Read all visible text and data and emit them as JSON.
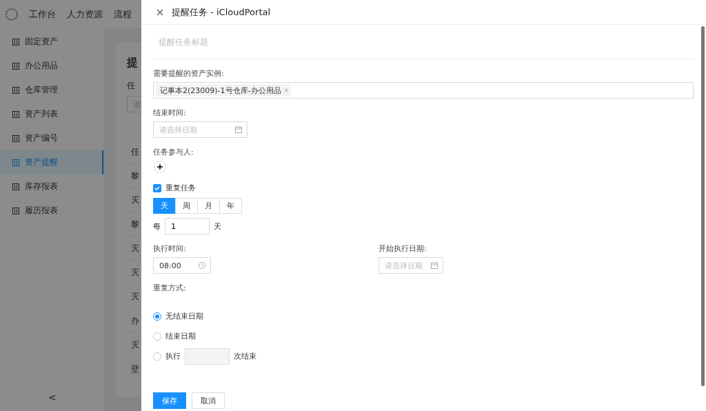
{
  "top_nav": {
    "items": [
      "工作台",
      "人力资源",
      "流程"
    ]
  },
  "sidebar": {
    "items": [
      {
        "label": "固定资产",
        "selected": false
      },
      {
        "label": "办公用品",
        "selected": false
      },
      {
        "label": "仓库管理",
        "selected": false
      },
      {
        "label": "资产列表",
        "selected": false
      },
      {
        "label": "资产编号",
        "selected": false
      },
      {
        "label": "资产提醒",
        "selected": true
      },
      {
        "label": "库存报表",
        "selected": false
      },
      {
        "label": "履历报表",
        "selected": false
      }
    ],
    "collapse": "<"
  },
  "page": {
    "title": "提",
    "filter_label": "任",
    "filter_placeholder": "请",
    "table_header": "任",
    "rows": [
      "黎",
      "灭",
      "黎",
      "灭",
      "灭",
      "灭",
      "办",
      "灭",
      "壁"
    ]
  },
  "drawer": {
    "title": "提醒任务 - iCloudPortal",
    "title_placeholder": "提醒任务标题",
    "assets_label": "需要提醒的资产实例:",
    "asset_tags": [
      "记事本2(23009)-1号仓库-办公用品"
    ],
    "end_time_label": "结束时间:",
    "end_time_placeholder": "请选择日期",
    "participants_label": "任务参与人:",
    "repeat": {
      "label": "重复任务",
      "checked": true
    },
    "periods": [
      {
        "label": "天",
        "selected": true
      },
      {
        "label": "周",
        "selected": false
      },
      {
        "label": "月",
        "selected": false
      },
      {
        "label": "年",
        "selected": false
      }
    ],
    "every_prefix": "每",
    "every_value": "1",
    "every_unit": "天",
    "exec_time_label": "执行时间:",
    "exec_time_value": "08:00",
    "start_date_label": "开始执行日期:",
    "start_date_placeholder": "请选择日期",
    "repeat_mode_label": "重复方式:",
    "repeat_modes": [
      {
        "kind": "plain",
        "label": "无结束日期",
        "selected": true
      },
      {
        "kind": "plain",
        "label": "结束日期",
        "selected": false
      },
      {
        "kind": "count",
        "label": "执行",
        "suffix": "次结束",
        "selected": false
      }
    ],
    "buttons": [
      {
        "label": "保存",
        "kind": "primary"
      },
      {
        "label": "取消",
        "kind": "default"
      }
    ]
  }
}
